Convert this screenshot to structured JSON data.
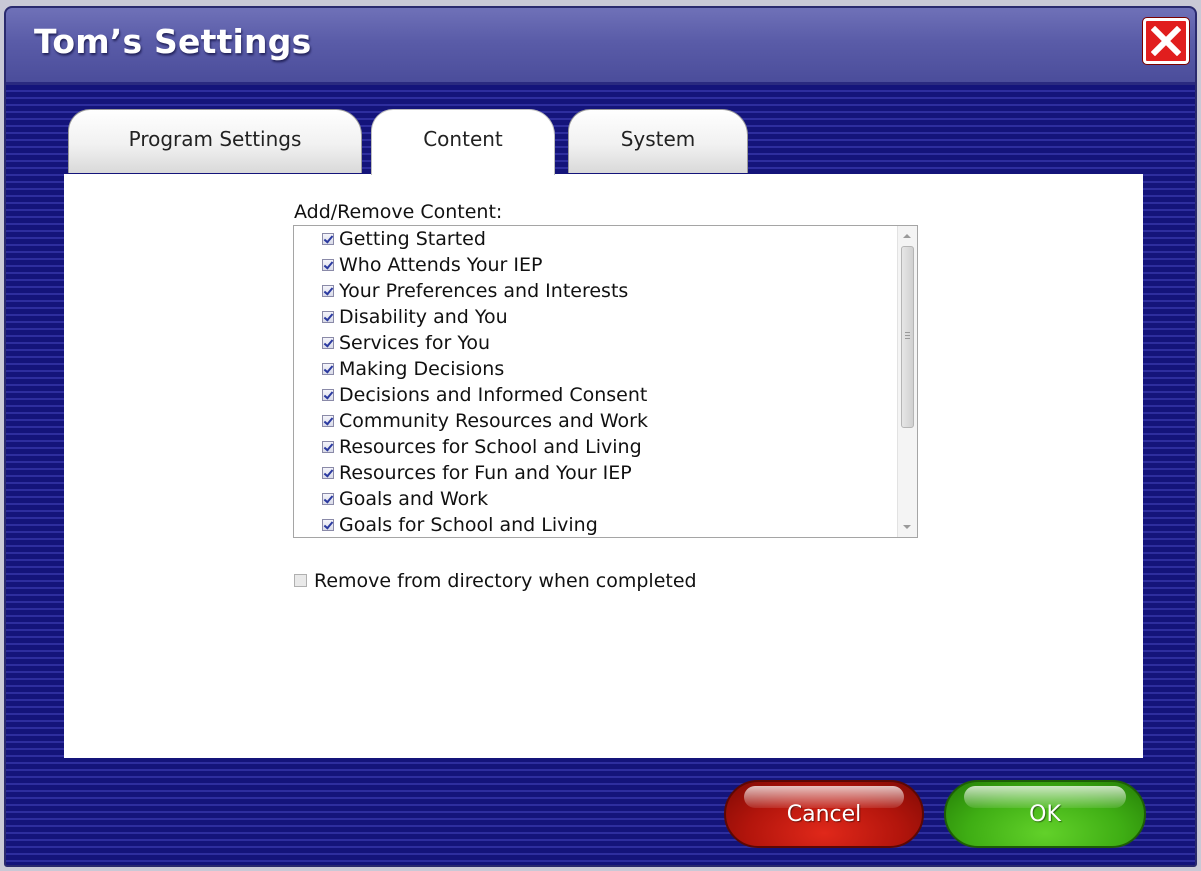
{
  "window": {
    "title": "Tom’s Settings"
  },
  "tabs": [
    {
      "label": "Program Settings",
      "active": false
    },
    {
      "label": "Content",
      "active": true
    },
    {
      "label": "System",
      "active": false
    }
  ],
  "content": {
    "section_label": "Add/Remove Content:",
    "items": [
      {
        "label": "Getting Started",
        "checked": true
      },
      {
        "label": "Who Attends Your IEP",
        "checked": true
      },
      {
        "label": "Your Preferences and Interests",
        "checked": true
      },
      {
        "label": "Disability and You",
        "checked": true
      },
      {
        "label": "Services for You",
        "checked": true
      },
      {
        "label": "Making Decisions",
        "checked": true
      },
      {
        "label": "Decisions and Informed Consent",
        "checked": true
      },
      {
        "label": "Community Resources and Work",
        "checked": true
      },
      {
        "label": "Resources for School and Living",
        "checked": true
      },
      {
        "label": "Resources for Fun and Your IEP",
        "checked": true
      },
      {
        "label": "Goals and Work",
        "checked": true
      },
      {
        "label": "Goals for School and Living",
        "checked": true
      }
    ],
    "remove_option": {
      "label": "Remove from directory when completed",
      "checked": false
    }
  },
  "buttons": {
    "cancel": "Cancel",
    "ok": "OK"
  },
  "icons": {
    "close": "close-x-icon"
  },
  "colors": {
    "background": "#14147a",
    "cancel": "#b3150c",
    "ok": "#3fae14",
    "close": "#e11e1e"
  }
}
